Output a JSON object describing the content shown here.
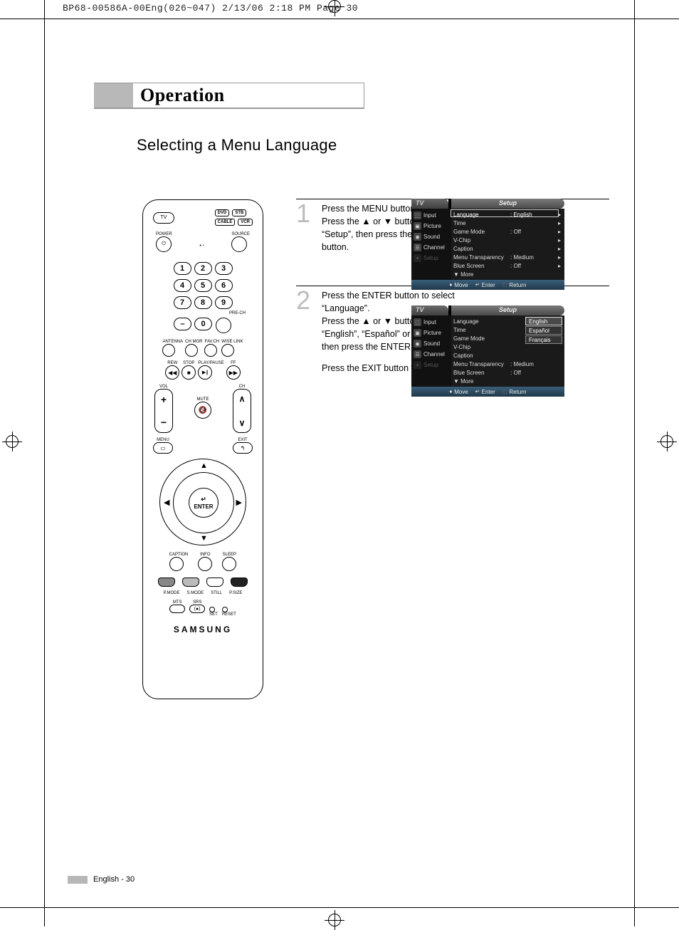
{
  "slug": "BP68-00586A-00Eng(026~047)  2/13/06  2:18 PM  Page 30",
  "section_title": "Operation",
  "subtitle": "Selecting a Menu Language",
  "remote": {
    "modes": {
      "tv": "TV",
      "dvd": "DVD",
      "stb": "STB",
      "cable": "CABLE",
      "vcr": "VCR"
    },
    "power": "POWER",
    "source": "SOURCE",
    "prech": "PRE-CH",
    "row_antenna": [
      "ANTENNA",
      "CH MGR",
      "FAV.CH",
      "WISE LINK"
    ],
    "row_transport": [
      "REW",
      "STOP",
      "PLAY/PAUSE",
      "FF"
    ],
    "vol": "VOL",
    "ch": "CH",
    "mute": "MUTE",
    "menu": "MENU",
    "exit": "EXIT",
    "enter": "ENTER",
    "row_cis": [
      "CAPTION",
      "INFO",
      "SLEEP"
    ],
    "row_ps": [
      "P.MODE",
      "S.MODE",
      "STILL",
      "P.SIZE"
    ],
    "row_ms": [
      "MTS",
      "SRS"
    ],
    "set": "SET",
    "reset": "RESET",
    "brand": "SAMSUNG",
    "nums": [
      "1",
      "2",
      "3",
      "4",
      "5",
      "6",
      "7",
      "8",
      "9",
      "0"
    ],
    "dash": "–"
  },
  "steps": {
    "s1num": "1",
    "s1a": "Press the MENU button.",
    "s1b": "Press the ▲ or ▼ button to select “Setup”, then press the ENTER button.",
    "s2num": "2",
    "s2a": "Press the ENTER button to select “Language”.",
    "s2b": "Press the ▲ or ▼ button to select “English”, “Español” or “Français”, then press the ENTER button.",
    "s2c": "Press the EXIT button to exit."
  },
  "osd": {
    "tv": "TV",
    "title": "Setup",
    "sidebar": {
      "input": "Input",
      "picture": "Picture",
      "sound": "Sound",
      "channel": "Channel",
      "setup": "Setup"
    },
    "items": {
      "language": "Language",
      "language_v": ": English",
      "time": "Time",
      "game": "Game Mode",
      "game_v": ": Off",
      "vchip": "V-Chip",
      "caption": "Caption",
      "menutrans": "Menu Transparency",
      "menutrans_v": ": Medium",
      "bluescreen": "Blue Screen",
      "bluescreen_v": ": Off",
      "more": "▼ More"
    },
    "footer": {
      "move": "Move",
      "enter": "Enter",
      "return": "Return"
    },
    "langs": {
      "en": "English",
      "es": "Español",
      "fr": "Français"
    }
  },
  "footer": {
    "lang": "English - ",
    "page": "30"
  }
}
